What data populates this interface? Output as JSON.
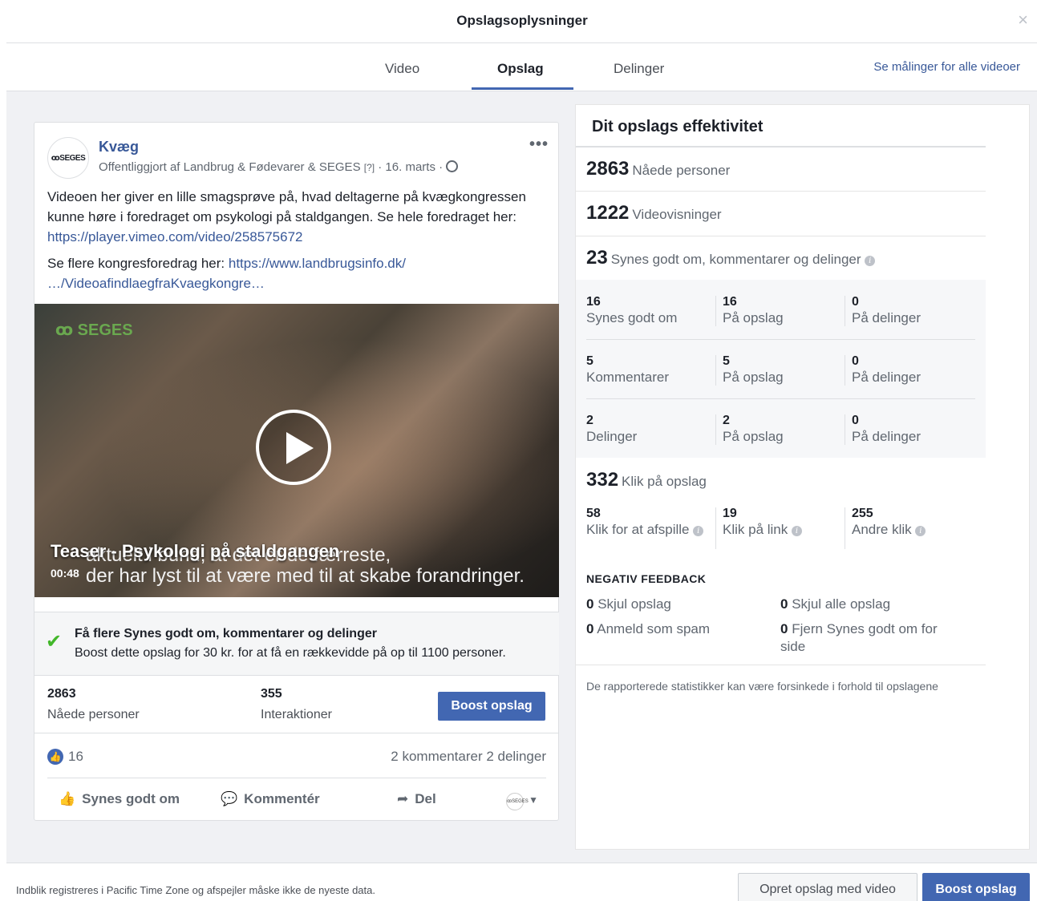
{
  "dialog": {
    "title": "Opslagsoplysninger",
    "close": "×"
  },
  "tabs": [
    {
      "label": "Video"
    },
    {
      "label": "Opslag"
    },
    {
      "label": "Delinger"
    }
  ],
  "tabs_link": "Se målinger for alle videoer",
  "post": {
    "page_name": "Kvæg",
    "avatar_text": "ꝏSEGES",
    "published_prefix": "Offentliggjort af",
    "publisher": "Landbrug & Fødevarer & SEGES",
    "help": "[?]",
    "date": "· 16. marts ·",
    "more": "•••",
    "text_1": "Videoen her giver en lille smagsprøve på, hvad deltagerne på kvægkongressen kunne høre i foredraget om psykologi på staldgangen.",
    "text_2_prefix": "Se hele foredraget her:",
    "text_2_link": "https://player.vimeo.com/video/258575672",
    "text_3_prefix": "Se flere kongresforedrag her:",
    "text_3_link": "https://www.landbrugsinfo.dk/ …/VideoafindlaegfraKvaegkongre…",
    "video": {
      "logo": "ꝏ SEGES",
      "title": "Teaser - Psykologi på staldgangen",
      "subtitle_1": "aktuelt i bund, at det er de færreste,",
      "subtitle_2": "der har lyst til at være med til at skabe forandringer.",
      "duration": "00:48"
    },
    "boost_box": {
      "heading": "Få flere Synes godt om, kommentarer og delinger",
      "sub": "Boost dette opslag for 30 kr. for at få en rækkevidde på op til 1100 personer."
    },
    "stats": {
      "reach_value": "2863",
      "reach_label": "Nåede personer",
      "interactions_value": "355",
      "interactions_label": "Interaktioner",
      "boost_button": "Boost opslag"
    },
    "reactions": {
      "likes": "16",
      "comments_shares": "2 kommentarer  2 delinger"
    },
    "actions": {
      "like": "Synes godt om",
      "comment": "Kommentér",
      "share": "Del"
    }
  },
  "panel": {
    "title": "Dit opslags effektivitet",
    "reach": {
      "value": "2863",
      "label": "Nåede personer"
    },
    "views": {
      "value": "1222",
      "label": "Videovisninger"
    },
    "engagement": {
      "value": "23",
      "label": "Synes godt om, kommentarer og delinger"
    },
    "grid": [
      {
        "v1": "16",
        "l1": "Synes godt om",
        "v2": "16",
        "l2": "På opslag",
        "v3": "0",
        "l3": "På delinger"
      },
      {
        "v1": "5",
        "l1": "Kommentarer",
        "v2": "5",
        "l2": "På opslag",
        "v3": "0",
        "l3": "På delinger"
      },
      {
        "v1": "2",
        "l1": "Delinger",
        "v2": "2",
        "l2": "På opslag",
        "v3": "0",
        "l3": "På delinger"
      }
    ],
    "clicks": {
      "value": "332",
      "label": "Klik på opslag"
    },
    "clicks_grid": [
      {
        "v": "58",
        "l": "Klik for at afspille"
      },
      {
        "v": "19",
        "l": "Klik på link"
      },
      {
        "v": "255",
        "l": "Andre klik"
      }
    ],
    "negative": {
      "title": "NEGATIV FEEDBACK",
      "items": [
        {
          "v": "0",
          "l": "Skjul opslag"
        },
        {
          "v": "0",
          "l": "Skjul alle opslag"
        },
        {
          "v": "0",
          "l": "Anmeld som spam"
        },
        {
          "v": "0",
          "l": "Fjern Synes godt om for side"
        }
      ]
    },
    "disclaimer": "De rapporterede statistikker kan være forsinkede i forhold til opslagene"
  },
  "footer": {
    "note": "Indblik registreres i Pacific Time Zone og afspejler måske ikke de nyeste data.",
    "create_button": "Opret opslag med video",
    "boost_button": "Boost opslag"
  },
  "colors": {
    "accent": "#4267b2",
    "link": "#385898",
    "success": "#42b72a"
  }
}
